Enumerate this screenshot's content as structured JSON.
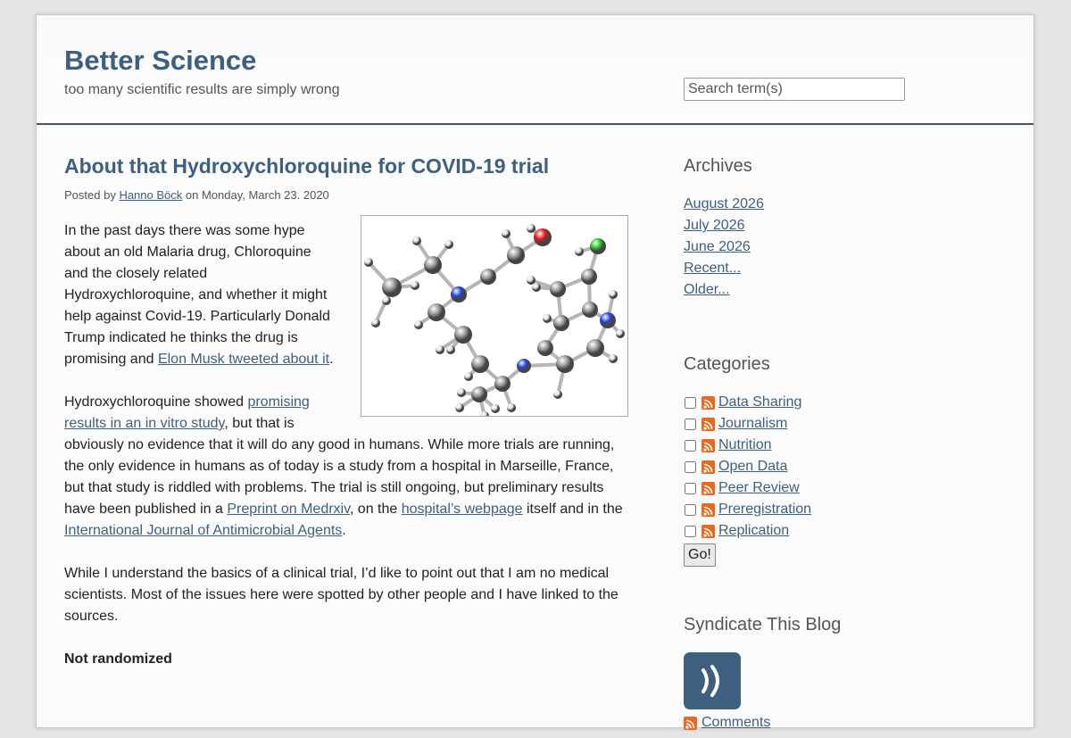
{
  "site": {
    "title": "Better Science",
    "tagline": "too many scientific results are simply wrong"
  },
  "search": {
    "placeholder": "Search term(s)"
  },
  "post": {
    "title": "About that Hydroxychloroquine for COVID-19 trial",
    "meta_prefix": "Posted by ",
    "author": "Hanno Böck",
    "meta_suffix": " on Monday, March 23. 2020",
    "p1_text": "In the past days there was some hype about an old Malaria drug, Chloroquine and the closely related Hydroxychloroquine, and whether it might help against Covid-19. Particularly Donald Trump indicated he thinks the drug is promising and ",
    "p1_link": "Elon Musk tweeted about it",
    "p1_end": ".",
    "p2_a": "Hydroxychloroquine showed ",
    "p2_link1": "promising results in an in vitro study",
    "p2_b": ", but that is obviously no evidence that it will do any good in humans. While more trials are running, the only evidence in humans as of today is a study from a hospital in Marseille, France, but that study is riddled with problems. The trial is still ongoing, but preliminary results have been published in a ",
    "p2_link2": "Preprint on Medrxiv",
    "p2_c": ", on the ",
    "p2_link3": "hospital’s webpage",
    "p2_d": " itself and in the ",
    "p2_link4": "International Journal of Antimicrobial Agents",
    "p2_end": ".",
    "p3": "While I understand the basics of a clinical trial, I’d like to point out that I am no medical scientists. Most of the issues here were spotted by other people and I have linked to the sources.",
    "subheading": "Not randomized"
  },
  "sidebar": {
    "archives_heading": "Archives",
    "archives": [
      "August 2026",
      "July 2026",
      "June 2026",
      "Recent...",
      "Older..."
    ],
    "categories_heading": "Categories",
    "categories": [
      "Data Sharing",
      "Journalism",
      "Nutrition",
      "Open Data",
      "Peer Review",
      "Preregistration",
      "Replication"
    ],
    "go_label": "Go!",
    "syndicate_heading": "Syndicate This Blog",
    "comments_label": "Comments"
  },
  "colors": {
    "accent": "#3d5f80",
    "rss": "#e86a1f",
    "carbon": "#999999",
    "nitrogen": "#2244ee",
    "oxygen": "#ee1111",
    "chlorine": "#22cc22",
    "hydrogen": "#dddddd"
  },
  "icons": [
    "molecule-illustration",
    "rss-feed-icon",
    "feed-icon"
  ]
}
